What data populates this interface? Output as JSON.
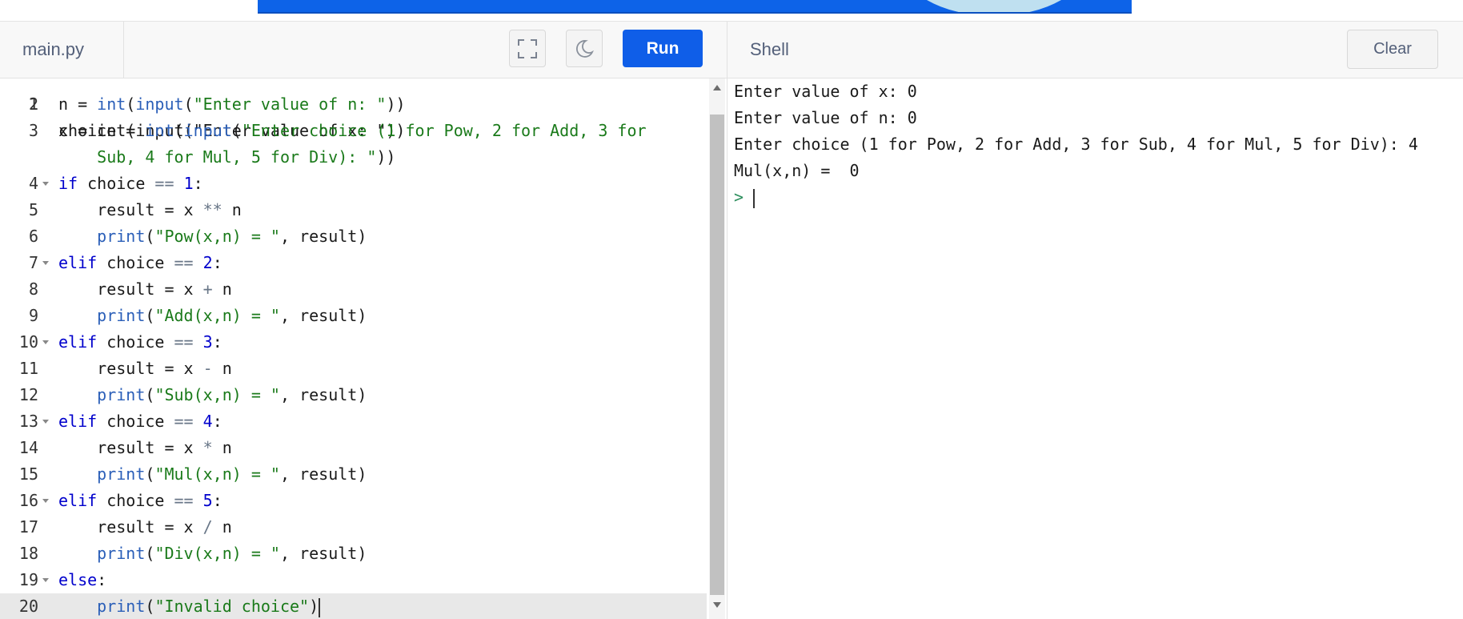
{
  "editor": {
    "filename": "main.py",
    "run_label": "Run",
    "partial_top_line": "x = int(input(\"Enter value of x: \"))",
    "lines": [
      {
        "num": "2",
        "fold": false,
        "active": false,
        "tokens": [
          [
            "n = ",
            ""
          ],
          [
            "int",
            "fn"
          ],
          [
            "(",
            ""
          ],
          [
            "input",
            "fn"
          ],
          [
            "(",
            ""
          ],
          [
            "\"Enter value of n: \"",
            "str"
          ],
          [
            "))",
            ""
          ]
        ]
      },
      {
        "num": "3",
        "fold": false,
        "active": false,
        "tokens": [
          [
            "choice = ",
            ""
          ],
          [
            "int",
            "fn"
          ],
          [
            "(",
            ""
          ],
          [
            "input",
            "fn"
          ],
          [
            "(",
            ""
          ],
          [
            "\"Enter choice (1 for Pow, 2 for Add, 3 for",
            "str"
          ]
        ]
      },
      {
        "num": "",
        "fold": false,
        "active": false,
        "tokens": [
          [
            "    ",
            ""
          ],
          [
            "Sub, 4 for Mul, 5 for Div): \"",
            "str"
          ],
          [
            "))",
            ""
          ]
        ]
      },
      {
        "num": "4",
        "fold": true,
        "active": false,
        "tokens": [
          [
            "if",
            "kw"
          ],
          [
            " choice ",
            ""
          ],
          [
            "==",
            "op"
          ],
          [
            " ",
            ""
          ],
          [
            "1",
            "num"
          ],
          [
            ":",
            ""
          ]
        ]
      },
      {
        "num": "5",
        "fold": false,
        "active": false,
        "tokens": [
          [
            "    result = x ",
            ""
          ],
          [
            "**",
            "op"
          ],
          [
            " n",
            ""
          ]
        ]
      },
      {
        "num": "6",
        "fold": false,
        "active": false,
        "tokens": [
          [
            "    ",
            ""
          ],
          [
            "print",
            "fn"
          ],
          [
            "(",
            ""
          ],
          [
            "\"Pow(x,n) = \"",
            "str"
          ],
          [
            ", result)",
            ""
          ]
        ]
      },
      {
        "num": "7",
        "fold": true,
        "active": false,
        "tokens": [
          [
            "elif",
            "kw"
          ],
          [
            " choice ",
            ""
          ],
          [
            "==",
            "op"
          ],
          [
            " ",
            ""
          ],
          [
            "2",
            "num"
          ],
          [
            ":",
            ""
          ]
        ]
      },
      {
        "num": "8",
        "fold": false,
        "active": false,
        "tokens": [
          [
            "    result = x ",
            ""
          ],
          [
            "+",
            "op"
          ],
          [
            " n",
            ""
          ]
        ]
      },
      {
        "num": "9",
        "fold": false,
        "active": false,
        "tokens": [
          [
            "    ",
            ""
          ],
          [
            "print",
            "fn"
          ],
          [
            "(",
            ""
          ],
          [
            "\"Add(x,n) = \"",
            "str"
          ],
          [
            ", result)",
            ""
          ]
        ]
      },
      {
        "num": "10",
        "fold": true,
        "active": false,
        "tokens": [
          [
            "elif",
            "kw"
          ],
          [
            " choice ",
            ""
          ],
          [
            "==",
            "op"
          ],
          [
            " ",
            ""
          ],
          [
            "3",
            "num"
          ],
          [
            ":",
            ""
          ]
        ]
      },
      {
        "num": "11",
        "fold": false,
        "active": false,
        "tokens": [
          [
            "    result = x ",
            ""
          ],
          [
            "-",
            "op"
          ],
          [
            " n",
            ""
          ]
        ]
      },
      {
        "num": "12",
        "fold": false,
        "active": false,
        "tokens": [
          [
            "    ",
            ""
          ],
          [
            "print",
            "fn"
          ],
          [
            "(",
            ""
          ],
          [
            "\"Sub(x,n) = \"",
            "str"
          ],
          [
            ", result)",
            ""
          ]
        ]
      },
      {
        "num": "13",
        "fold": true,
        "active": false,
        "tokens": [
          [
            "elif",
            "kw"
          ],
          [
            " choice ",
            ""
          ],
          [
            "==",
            "op"
          ],
          [
            " ",
            ""
          ],
          [
            "4",
            "num"
          ],
          [
            ":",
            ""
          ]
        ]
      },
      {
        "num": "14",
        "fold": false,
        "active": false,
        "tokens": [
          [
            "    result = x ",
            ""
          ],
          [
            "*",
            "op"
          ],
          [
            " n",
            ""
          ]
        ]
      },
      {
        "num": "15",
        "fold": false,
        "active": false,
        "tokens": [
          [
            "    ",
            ""
          ],
          [
            "print",
            "fn"
          ],
          [
            "(",
            ""
          ],
          [
            "\"Mul(x,n) = \"",
            "str"
          ],
          [
            ", result)",
            ""
          ]
        ]
      },
      {
        "num": "16",
        "fold": true,
        "active": false,
        "tokens": [
          [
            "elif",
            "kw"
          ],
          [
            " choice ",
            ""
          ],
          [
            "==",
            "op"
          ],
          [
            " ",
            ""
          ],
          [
            "5",
            "num"
          ],
          [
            ":",
            ""
          ]
        ]
      },
      {
        "num": "17",
        "fold": false,
        "active": false,
        "tokens": [
          [
            "    result = x ",
            ""
          ],
          [
            "/",
            "op"
          ],
          [
            " n",
            ""
          ]
        ]
      },
      {
        "num": "18",
        "fold": false,
        "active": false,
        "tokens": [
          [
            "    ",
            ""
          ],
          [
            "print",
            "fn"
          ],
          [
            "(",
            ""
          ],
          [
            "\"Div(x,n) = \"",
            "str"
          ],
          [
            ", result)",
            ""
          ]
        ]
      },
      {
        "num": "19",
        "fold": true,
        "active": false,
        "tokens": [
          [
            "else",
            "kw"
          ],
          [
            ":",
            ""
          ]
        ]
      },
      {
        "num": "20",
        "fold": false,
        "active": true,
        "tokens": [
          [
            "    ",
            ""
          ],
          [
            "print",
            "fn"
          ],
          [
            "(",
            ""
          ],
          [
            "\"Invalid choice\"",
            "str"
          ],
          [
            ")",
            ""
          ]
        ]
      }
    ]
  },
  "shell": {
    "title": "Shell",
    "clear_label": "Clear",
    "output": [
      "Enter value of x: 0",
      "Enter value of n: 0",
      "Enter choice (1 for Pow, 2 for Add, 3 for Sub, 4 for Mul, 5 for Div): 4",
      "Mul(x,n) =  0"
    ],
    "prompt": ">"
  },
  "icons": {
    "fullscreen": "fullscreen-icon",
    "theme": "moon-icon"
  },
  "colors": {
    "run_button": "#0f5ee8",
    "ad_banner": "#0d63e8"
  }
}
